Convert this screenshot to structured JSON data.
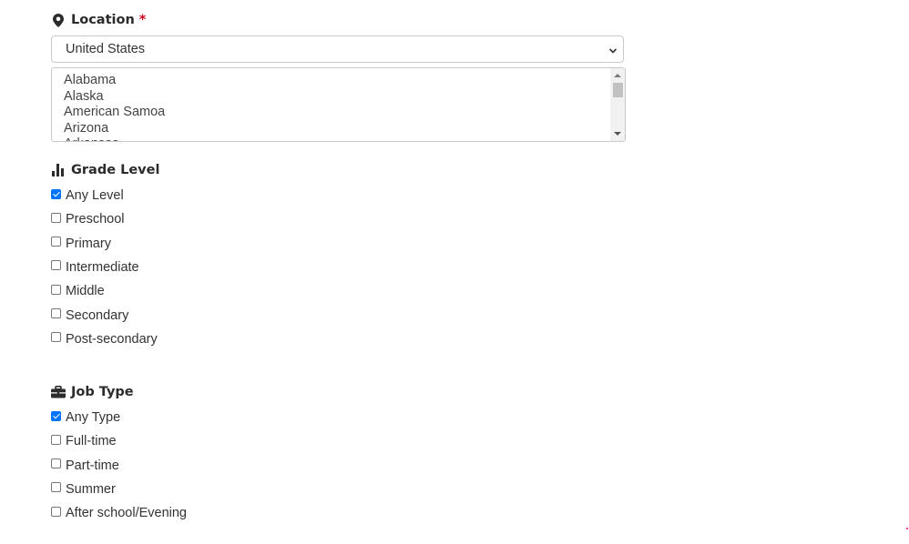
{
  "location": {
    "title": "Location",
    "required_mark": "*",
    "country_selected": "United States",
    "states": [
      "Alabama",
      "Alaska",
      "American Samoa",
      "Arizona",
      "Arkansas"
    ]
  },
  "grade_level": {
    "title": "Grade Level",
    "options": [
      {
        "label": "Any Level",
        "checked": true
      },
      {
        "label": "Preschool",
        "checked": false
      },
      {
        "label": "Primary",
        "checked": false
      },
      {
        "label": "Intermediate",
        "checked": false
      },
      {
        "label": "Middle",
        "checked": false
      },
      {
        "label": "Secondary",
        "checked": false
      },
      {
        "label": "Post-secondary",
        "checked": false
      }
    ]
  },
  "job_type": {
    "title": "Job Type",
    "options": [
      {
        "label": "Any Type",
        "checked": true
      },
      {
        "label": "Full-time",
        "checked": false
      },
      {
        "label": "Part-time",
        "checked": false
      },
      {
        "label": "Summer",
        "checked": false
      },
      {
        "label": "After school/Evening",
        "checked": false
      }
    ]
  },
  "colors": {
    "accent": "#0075ff",
    "required": "#d0021b",
    "border": "#c9c9c9"
  }
}
